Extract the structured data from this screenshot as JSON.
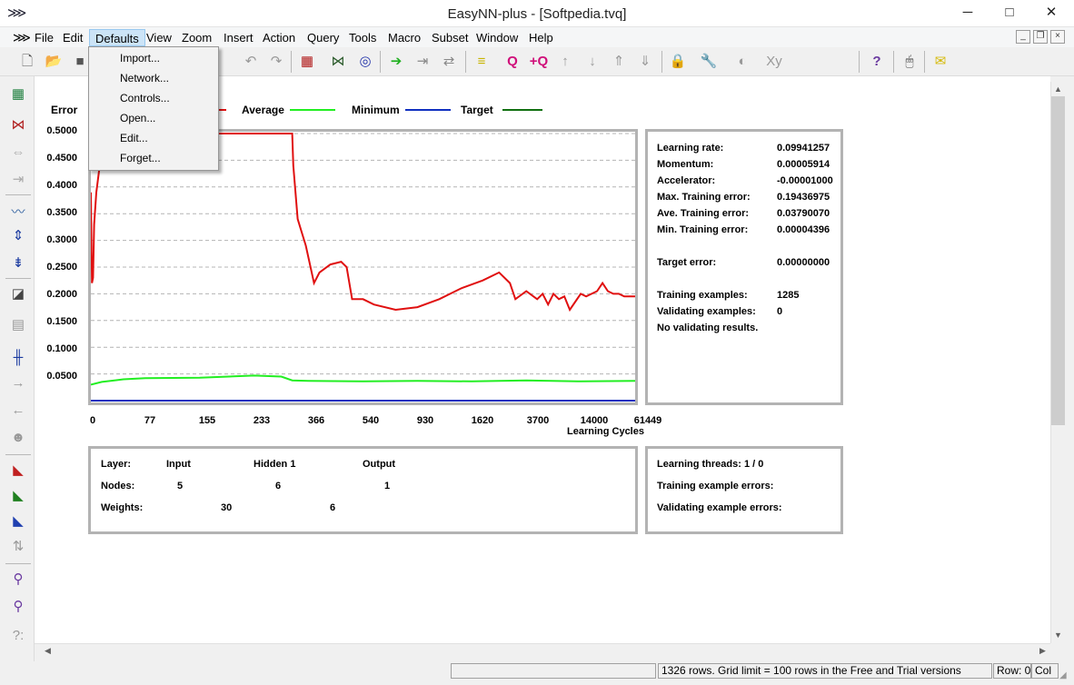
{
  "window": {
    "title": "EasyNN-plus - [Softpedia.tvq]",
    "minimize": "─",
    "maximize": "□",
    "close": "✕"
  },
  "menu": [
    "File",
    "Edit",
    "Defaults",
    "View",
    "Zoom",
    "Insert",
    "Action",
    "Query",
    "Tools",
    "Macro",
    "Subset",
    "Window",
    "Help"
  ],
  "defaults_menu": [
    "Import...",
    "Network...",
    "Controls...",
    "Open...",
    "Edit...",
    "Forget..."
  ],
  "legend": {
    "series": "Error",
    "average": "Average",
    "minimum": "Minimum",
    "target": "Target"
  },
  "colors": {
    "maximum": "#e01010",
    "average": "#22ee22",
    "minimum": "#1030c0",
    "target": "#107010"
  },
  "chart_data": {
    "type": "line",
    "ylabel": "Error",
    "xlabel": "Learning Cycles",
    "y_ticks": [
      "0.5000",
      "0.4500",
      "0.4000",
      "0.3500",
      "0.3000",
      "0.2500",
      "0.2000",
      "0.1500",
      "0.1000",
      "0.0500"
    ],
    "x_ticks": [
      "0",
      "77",
      "155",
      "233",
      "366",
      "540",
      "930",
      "1620",
      "3700",
      "14000",
      "61449"
    ],
    "ylim": [
      0,
      0.5
    ],
    "xlim": [
      0,
      1
    ],
    "grid": true,
    "series": [
      {
        "name": "Maximum",
        "color": "#e01010",
        "x": [
          0,
          0.002,
          0.004,
          0.006,
          0.01,
          0.015,
          0.022,
          0.03,
          0.038,
          0.045,
          0.06,
          0.1,
          0.2,
          0.3,
          0.37,
          0.372,
          0.38,
          0.395,
          0.41,
          0.42,
          0.44,
          0.46,
          0.47,
          0.48,
          0.5,
          0.52,
          0.56,
          0.6,
          0.64,
          0.68,
          0.72,
          0.75,
          0.77,
          0.78,
          0.8,
          0.82,
          0.83,
          0.84,
          0.85,
          0.86,
          0.87,
          0.88,
          0.9,
          0.91,
          0.92,
          0.93,
          0.94,
          0.95,
          0.96,
          0.97,
          0.98,
          1
        ],
        "y": [
          0.39,
          0.22,
          0.23,
          0.33,
          0.39,
          0.43,
          0.46,
          0.48,
          0.5,
          0.5,
          0.5,
          0.5,
          0.5,
          0.5,
          0.5,
          0.44,
          0.34,
          0.29,
          0.22,
          0.24,
          0.255,
          0.26,
          0.25,
          0.19,
          0.19,
          0.18,
          0.17,
          0.175,
          0.19,
          0.21,
          0.225,
          0.24,
          0.22,
          0.19,
          0.205,
          0.19,
          0.2,
          0.18,
          0.2,
          0.19,
          0.195,
          0.17,
          0.2,
          0.195,
          0.2,
          0.205,
          0.22,
          0.205,
          0.2,
          0.2,
          0.195,
          0.195
        ]
      },
      {
        "name": "Average",
        "color": "#22ee22",
        "x": [
          0,
          0.02,
          0.06,
          0.1,
          0.2,
          0.3,
          0.35,
          0.37,
          0.4,
          0.5,
          0.6,
          0.7,
          0.8,
          0.9,
          1
        ],
        "y": [
          0.03,
          0.035,
          0.04,
          0.042,
          0.043,
          0.047,
          0.045,
          0.038,
          0.037,
          0.036,
          0.037,
          0.036,
          0.038,
          0.036,
          0.037
        ]
      },
      {
        "name": "Minimum",
        "color": "#1030c0",
        "x": [
          0,
          1
        ],
        "y": [
          0.0,
          0.0
        ]
      }
    ]
  },
  "learning_stats": [
    {
      "label": "Learning rate:",
      "value": "0.09941257"
    },
    {
      "label": "Momentum:",
      "value": "0.00005914"
    },
    {
      "label": "Accelerator:",
      "value": "-0.00001000"
    },
    {
      "label": "Max. Training error:",
      "value": "0.19436975"
    },
    {
      "label": "Ave. Training error:",
      "value": "0.03790070"
    },
    {
      "label": "Min. Training error:",
      "value": "0.00004396"
    },
    {
      "label": "Target error:",
      "value": "0.00000000"
    },
    {
      "label": "Training examples:",
      "value": "1285"
    },
    {
      "label": "Validating examples:",
      "value": "0"
    },
    {
      "label": "No validating results.",
      "value": ""
    }
  ],
  "network": {
    "layer_label": "Layer:",
    "input": "Input",
    "hidden": "Hidden 1",
    "output": "Output",
    "nodes_label": "Nodes:",
    "nodes_input": "5",
    "nodes_hidden": "6",
    "nodes_output": "1",
    "weights_label": "Weights:",
    "weights_ih": "30",
    "weights_ho": "6"
  },
  "threads": {
    "threads": "Learning threads: 1 / 0",
    "training_errors": "Training example errors:",
    "validating_errors": "Validating example errors:"
  },
  "status": {
    "message": "1326 rows. Grid limit = 100 rows in the Free and Trial versions",
    "row": "Row: 0",
    "col": "Col"
  }
}
